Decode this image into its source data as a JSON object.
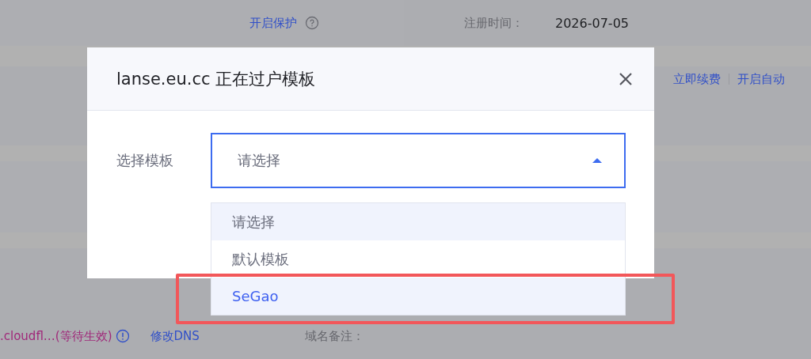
{
  "page": {
    "protect_link": "开启保护",
    "register_label": "注册时间：",
    "register_date": "2026-07-05",
    "renew_link": "立即续费",
    "auto_link": "开启自动",
    "dns_status": ".cloudfl…(等待生效)",
    "dns_link": "修改DNS",
    "note_label": "域名备注："
  },
  "dialog": {
    "title": "lanse.eu.cc 正在过户模板",
    "field_label": "选择模板",
    "select": {
      "placeholder": "请选择",
      "expanded": true
    },
    "options": [
      {
        "label": "请选择",
        "selected": false,
        "highlighted": true
      },
      {
        "label": "默认模板",
        "selected": false,
        "highlighted": false
      },
      {
        "label": "SeGao",
        "selected": true,
        "highlighted": true
      }
    ]
  }
}
